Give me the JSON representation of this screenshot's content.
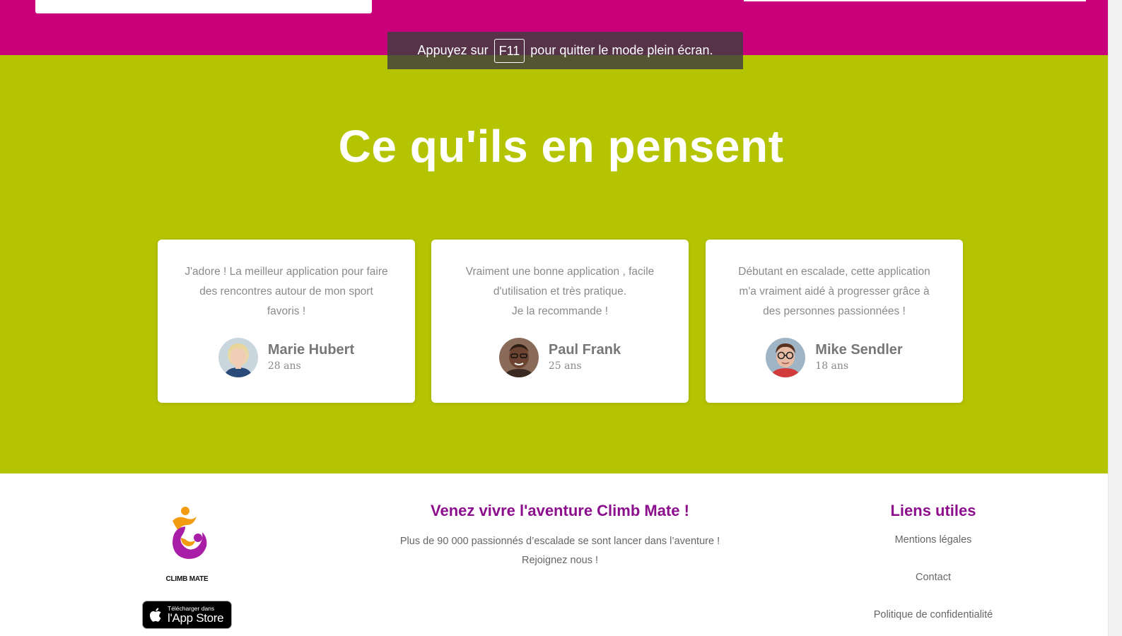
{
  "fullscreen_notice": {
    "prefix": "Appuyez sur",
    "key": "F11",
    "suffix": "pour quitter le mode plein écran."
  },
  "testimonials_section": {
    "title": "Ce qu'ils en pensent",
    "background_color": "#b5c400",
    "items": [
      {
        "quote_lines": [
          "J'adore ! La meilleur application pour faire",
          "des rencontres autour de mon sport",
          "favoris !"
        ],
        "name": "Marie Hubert",
        "age": "28 ans",
        "avatar_icon": "woman-portrait"
      },
      {
        "quote_lines": [
          "Vraiment une bonne application , facile",
          "d'utilisation et très pratique.",
          "Je la recommande !"
        ],
        "name": "Paul Frank",
        "age": "25 ans",
        "avatar_icon": "man-portrait"
      },
      {
        "quote_lines": [
          "Débutant en escalade, cette application",
          "m'a vraiment aidé à progresser grâce à",
          "des personnes passionnées !"
        ],
        "name": "Mike Sendler",
        "age": "18 ans",
        "avatar_icon": "man-glasses-portrait"
      }
    ]
  },
  "header_band": {
    "color": "#c8007a"
  },
  "footer": {
    "logo": {
      "text": "CLIMB MATE",
      "icon": "climber-logo-icon"
    },
    "app_store": {
      "small_label": "Télécharger dans",
      "big_label": "l'App Store",
      "icon": "apple-icon"
    },
    "center": {
      "heading": "Venez vivre l'aventure Climb Mate !",
      "line1": "Plus de 90 000 passionnés d’escalade se sont lancer dans l’aventure !",
      "line2": "Rejoignez nous !"
    },
    "links": {
      "heading": "Liens utiles",
      "items": [
        "Mentions légales",
        "Contact",
        "Politique de confidentialité"
      ]
    },
    "accent_color": "#8b0f8c"
  }
}
